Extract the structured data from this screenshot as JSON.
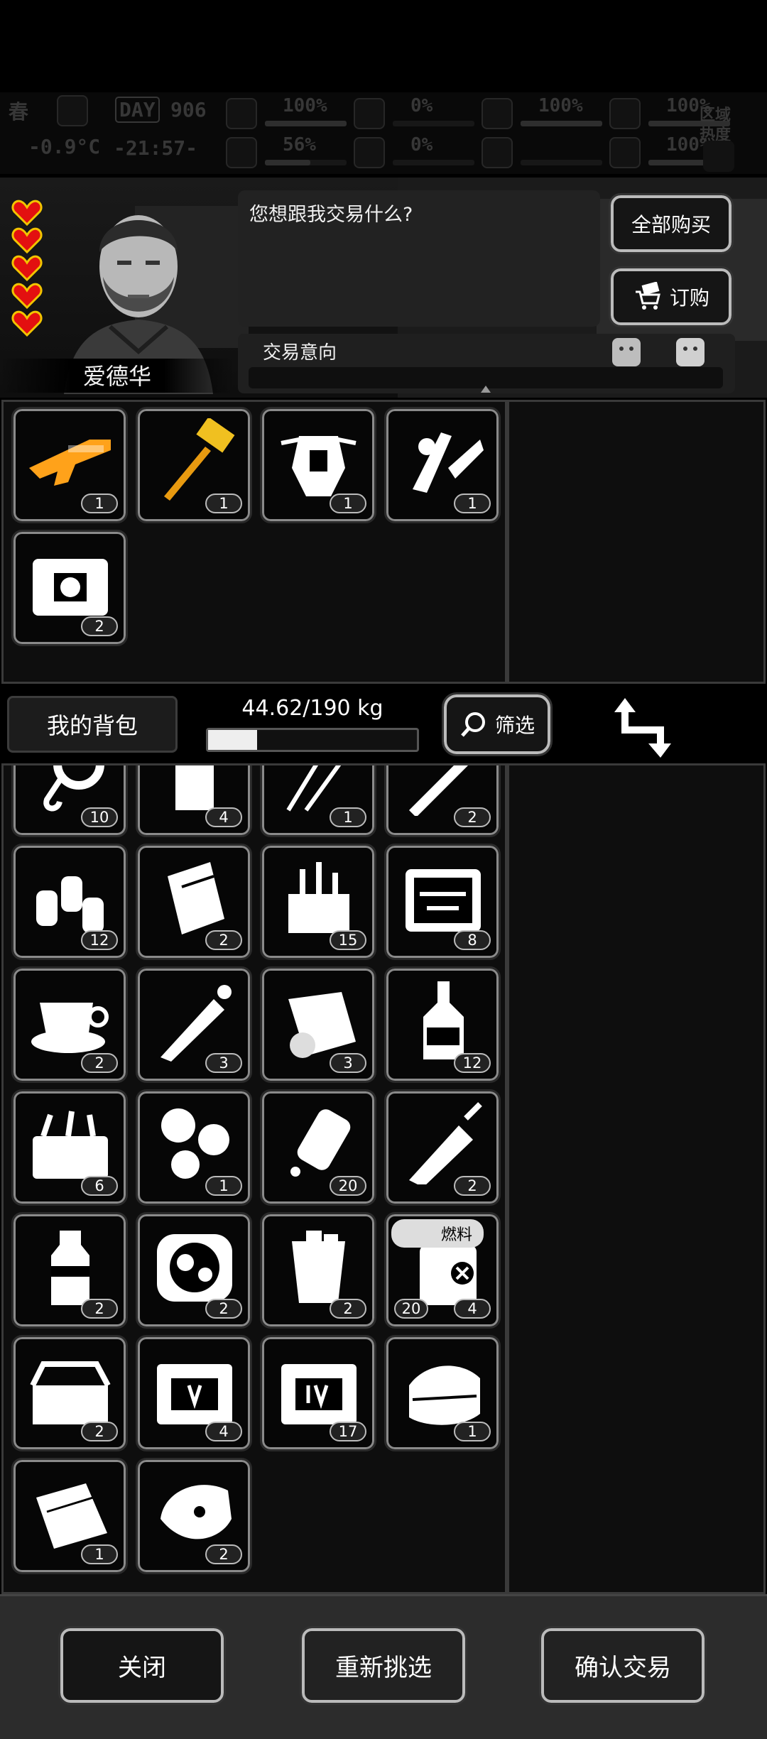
{
  "status": {
    "season": "春",
    "temperature": "-0.9°C",
    "day_label": "DAY",
    "day_number": "906",
    "time": "-21:57-",
    "stats": [
      {
        "icon": "medkit-icon",
        "value": "100%",
        "level": 1.0
      },
      {
        "icon": "blood-drop-icon",
        "value": "0%",
        "level": 0.0
      },
      {
        "icon": "stomach-icon",
        "value": "100%",
        "level": 1.0
      },
      {
        "icon": "flask-icon",
        "value": "100%",
        "level": 1.0
      },
      {
        "icon": "brain-icon",
        "value": "56%",
        "level": 0.56
      },
      {
        "icon": "bleeding-icon",
        "value": "0%",
        "level": 0.0
      },
      {
        "icon": "heart-icon",
        "value": "",
        "level": 0.0
      },
      {
        "icon": "energy-icon",
        "value": "100%",
        "level": 1.0
      }
    ],
    "zone_label": "区域",
    "heat_label": "热度"
  },
  "npc": {
    "name": "爱德华",
    "hearts": 5,
    "dialog": "您想跟我交易什么?"
  },
  "actions": {
    "buy_all": "全部购买",
    "order": "订购"
  },
  "intent": {
    "label": "交易意向",
    "level": 0.5
  },
  "trader_items": [
    {
      "icon": "rifle-icon",
      "count": "1"
    },
    {
      "icon": "hammer-icon",
      "count": "1"
    },
    {
      "icon": "armor-icon",
      "count": "1"
    },
    {
      "icon": "scrap-parts-icon",
      "count": "1"
    },
    {
      "icon": "supply-crate-icon",
      "count": "2"
    }
  ],
  "toolbar": {
    "my_bag": "我的背包",
    "weight": "44.62/190 kg",
    "weight_fraction": 0.2348,
    "filter": "筛选"
  },
  "bag_items": [
    {
      "icon": "rope-hook-icon",
      "count": "10"
    },
    {
      "icon": "water-bottle-icon",
      "count": "4"
    },
    {
      "icon": "lockpick-icon",
      "count": "1"
    },
    {
      "icon": "cigarette-icon",
      "count": "2"
    },
    {
      "icon": "spray-cans-icon",
      "count": "12"
    },
    {
      "icon": "paper-rolls-icon",
      "count": "2"
    },
    {
      "icon": "tool-bag-icon",
      "count": "15"
    },
    {
      "icon": "tool-case-icon",
      "count": "8"
    },
    {
      "icon": "coffee-cup-icon",
      "count": "2"
    },
    {
      "icon": "syringe-icon",
      "count": "3"
    },
    {
      "icon": "bandage-icon",
      "count": "3"
    },
    {
      "icon": "liquor-bottle-icon",
      "count": "12"
    },
    {
      "icon": "toolbox-icon",
      "count": "6"
    },
    {
      "icon": "pills-icon",
      "count": "1"
    },
    {
      "icon": "pill-bottle-icon",
      "count": "20"
    },
    {
      "icon": "adrenaline-icon",
      "count": "2"
    },
    {
      "icon": "soda-bottle-icon",
      "count": "2"
    },
    {
      "icon": "food-pot-icon",
      "count": "2"
    },
    {
      "icon": "iced-drink-icon",
      "count": "2"
    },
    {
      "icon": "fuel-canister-icon",
      "count": "4",
      "left_count": "20",
      "tag": "燃料"
    },
    {
      "icon": "open-toolbox-icon",
      "count": "2"
    },
    {
      "icon": "crate-v-icon",
      "count": "4"
    },
    {
      "icon": "crate-iv-icon",
      "count": "17"
    },
    {
      "icon": "cloth-icon",
      "count": "1"
    },
    {
      "icon": "towel-icon",
      "count": "1"
    },
    {
      "icon": "meat-icon",
      "count": "2"
    }
  ],
  "bottom": {
    "close": "关闭",
    "reselect": "重新挑选",
    "confirm": "确认交易"
  }
}
